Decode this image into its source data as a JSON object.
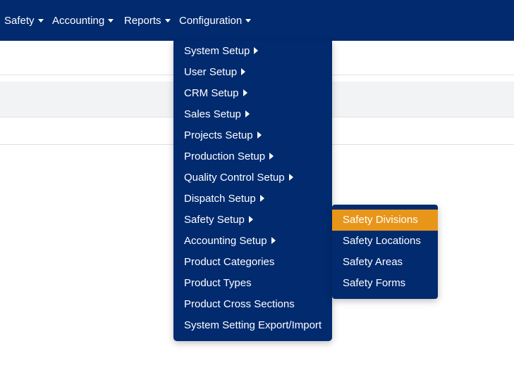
{
  "colors": {
    "navbar": "#012a6f",
    "menu": "#012a6f",
    "active_item": "#e8961a",
    "text": "#ffffff"
  },
  "navbar": {
    "items": [
      {
        "label": "Safety"
      },
      {
        "label": "Accounting"
      },
      {
        "label": "Reports"
      },
      {
        "label": "Configuration"
      }
    ]
  },
  "configuration_menu": {
    "items": [
      {
        "label": "System Setup"
      },
      {
        "label": "User Setup"
      },
      {
        "label": "CRM Setup"
      },
      {
        "label": "Sales Setup"
      },
      {
        "label": "Projects Setup"
      },
      {
        "label": "Production Setup"
      },
      {
        "label": "Quality Control Setup"
      },
      {
        "label": "Dispatch Setup"
      },
      {
        "label": "Safety Setup"
      },
      {
        "label": "Accounting Setup"
      },
      {
        "label": "Product Categories"
      },
      {
        "label": "Product Types"
      },
      {
        "label": "Product Cross Sections"
      },
      {
        "label": "System Setting Export/Import"
      }
    ]
  },
  "safety_setup_submenu": {
    "active_item": "Safety Divisions",
    "items": [
      {
        "label": "Safety Divisions"
      },
      {
        "label": "Safety Locations"
      },
      {
        "label": "Safety Areas"
      },
      {
        "label": "Safety Forms"
      }
    ]
  }
}
